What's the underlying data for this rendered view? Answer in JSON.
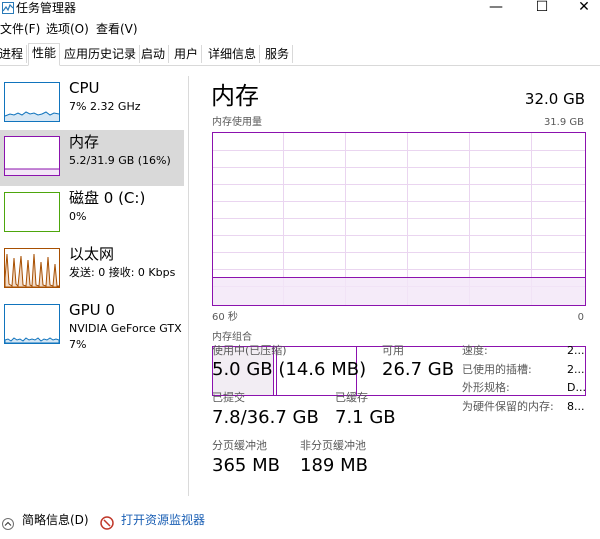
{
  "window": {
    "title": "任务管理器",
    "minimize_icon": "—",
    "maximize_icon": "☐",
    "close_icon": "✕"
  },
  "menu": [
    "文件(F)",
    "选项(O)",
    "查看(V)"
  ],
  "tabs": [
    "进程",
    "性能",
    "应用历史记录",
    "启动",
    "用户",
    "详细信息",
    "服务"
  ],
  "sidebar": {
    "items": [
      {
        "name": "CPU",
        "sub1": "7% 2.32 GHz",
        "sub2": ""
      },
      {
        "name": "内存",
        "sub1": "5.2/31.9 GB (16%)",
        "sub2": ""
      },
      {
        "name": "磁盘 0 (C:)",
        "sub1": "0%",
        "sub2": ""
      },
      {
        "name": "以太网",
        "sub1": "发送: 0 接收: 0 Kbps",
        "sub2": ""
      },
      {
        "name": "GPU 0",
        "sub1": "NVIDIA GeForce GTX",
        "sub2": "7%"
      }
    ]
  },
  "main": {
    "title": "内存",
    "capacity": "32.0 GB",
    "usage_label": "内存使用量",
    "usage_max": "31.9 GB",
    "axis_left": "60 秒",
    "axis_right": "0",
    "composition_label": "内存组合",
    "stats": {
      "in_use_label": "使用中(已压缩)",
      "in_use_value": "5.0 GB (14.6 MB)",
      "available_label": "可用",
      "available_value": "26.7 GB",
      "committed_label": "已提交",
      "committed_value": "7.8/36.7 GB",
      "cached_label": "已缓存",
      "cached_value": "7.1 GB",
      "paged_label": "分页缓冲池",
      "paged_value": "365 MB",
      "nonpaged_label": "非分页缓冲池",
      "nonpaged_value": "189 MB"
    },
    "right_stats": {
      "speed_label": "速度:",
      "speed_value": "2...",
      "slots_label": "已使用的插槽:",
      "slots_value": "2...",
      "form_label": "外形规格:",
      "form_value": "D...",
      "reserved_label": "为硬件保留的内存:",
      "reserved_value": "8..."
    }
  },
  "footer": {
    "brief": "简略信息(D)",
    "monitor": "打开资源监视器"
  },
  "colors": {
    "cpu": "#1174bd",
    "memory": "#8b12ae",
    "disk": "#4da60c",
    "ethernet": "#a74f01",
    "gpu": "#1174bd"
  }
}
